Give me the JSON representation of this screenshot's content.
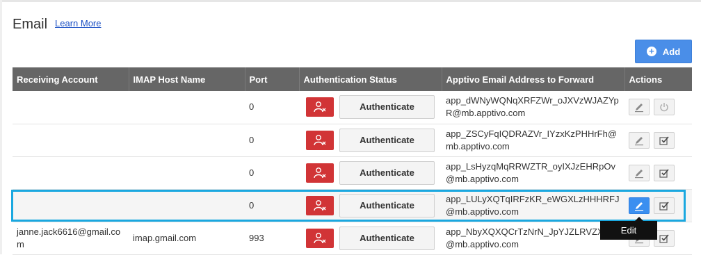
{
  "header": {
    "title": "Email",
    "learn_more": "Learn More",
    "add_label": "Add"
  },
  "table": {
    "columns": [
      "Receiving Account",
      "IMAP Host Name",
      "Port",
      "Authentication Status",
      "Apptivo Email Address to Forward",
      "Actions"
    ],
    "rows": [
      {
        "account": "",
        "host": "",
        "port": "0",
        "authenticate_label": "Authenticate",
        "forward": "app_dWNyWQNqXRFZWr_oJXVzWJAZYpR@mb.apptivo.com",
        "second_action_icon": "power-icon"
      },
      {
        "account": "",
        "host": "",
        "port": "0",
        "authenticate_label": "Authenticate",
        "forward": "app_ZSCyFqIQDRAZVr_IYzxKzPHHrFh@mb.apptivo.com",
        "second_action_icon": "check-icon"
      },
      {
        "account": "",
        "host": "",
        "port": "0",
        "authenticate_label": "Authenticate",
        "forward": "app_LsHyzqMqRRWZTR_oyIXJzEHRpOv@mb.apptivo.com",
        "second_action_icon": "check-icon"
      },
      {
        "account": "",
        "host": "",
        "port": "0",
        "authenticate_label": "Authenticate",
        "forward": "app_LULyXQTqIRFzKR_eWGXLzHHHRFJ@mb.apptivo.com",
        "second_action_icon": "check-icon"
      },
      {
        "account": "janne.jack6616@gmail.com",
        "host": "imap.gmail.com",
        "port": "993",
        "authenticate_label": "Authenticate",
        "forward": "app_NbyXQXQCrTzNrN_JpYJZLRVZXVD@mb.apptivo.com",
        "second_action_icon": "check-icon"
      }
    ]
  },
  "tooltip": {
    "text": "Edit"
  },
  "colors": {
    "header_bg": "#666666",
    "accent": "#4a8ee8",
    "fail": "#d13436",
    "highlight": "#1aa8e0"
  }
}
